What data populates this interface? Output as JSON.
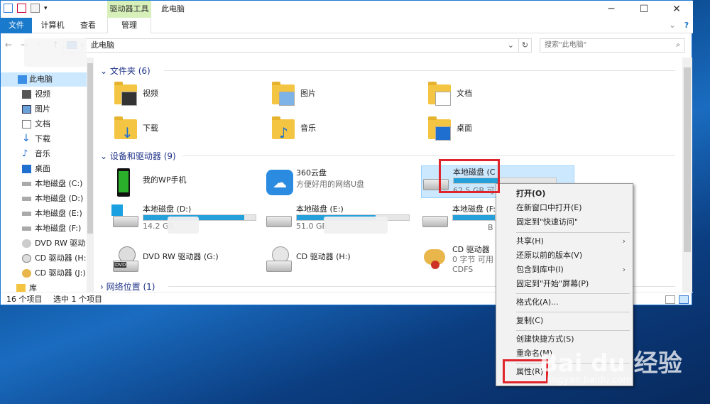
{
  "title_bar": {
    "context_tab": "驱动器工具",
    "window_title": "此电脑",
    "minimize": "─",
    "maximize": "☐",
    "close": "✕"
  },
  "ribbon": {
    "tabs": [
      "文件",
      "计算机",
      "查看",
      "管理"
    ],
    "collapse": "⌄",
    "help": "?"
  },
  "address": {
    "back": "←",
    "forward": "→",
    "dropdown": "⌄",
    "up": "↑",
    "path": "此电脑",
    "path_sep": "›",
    "history": "⌄",
    "refresh": "↻",
    "search_placeholder": "搜索\"此电脑\"",
    "search_icon": "⌕"
  },
  "sidebar": {
    "items": [
      {
        "label": "此电脑",
        "icon": "computer-icon",
        "selected": true
      },
      {
        "label": "视频",
        "icon": "video-icon"
      },
      {
        "label": "图片",
        "icon": "picture-icon"
      },
      {
        "label": "文档",
        "icon": "document-icon"
      },
      {
        "label": "下载",
        "icon": "download-icon"
      },
      {
        "label": "音乐",
        "icon": "music-icon"
      },
      {
        "label": "桌面",
        "icon": "desktop-icon"
      },
      {
        "label": "本地磁盘 (C:)",
        "icon": "drive-icon"
      },
      {
        "label": "本地磁盘 (D:)",
        "icon": "drive-icon"
      },
      {
        "label": "本地磁盘 (E:)",
        "icon": "drive-icon"
      },
      {
        "label": "本地磁盘 (F:)",
        "icon": "drive-icon"
      },
      {
        "label": "DVD RW 驱动",
        "icon": "dvd-icon"
      },
      {
        "label": "CD 驱动器 (H:",
        "icon": "cd-icon"
      },
      {
        "label": "CD 驱动器 (J:)",
        "icon": "cd-icon"
      },
      {
        "label": "库",
        "icon": "library-icon"
      }
    ]
  },
  "groups": {
    "folders": "文件夹 (6)",
    "devices": "设备和驱动器 (9)",
    "network": "网络位置 (1)",
    "chevron": "⌄",
    "chevron_right": "›"
  },
  "folders": [
    {
      "label": "视频"
    },
    {
      "label": "图片"
    },
    {
      "label": "文档"
    },
    {
      "label": "下载"
    },
    {
      "label": "音乐"
    },
    {
      "label": "桌面"
    }
  ],
  "devices": [
    {
      "label": "我的WP手机"
    },
    {
      "label": "360云盘",
      "sub": "方便好用的网络U盘"
    },
    {
      "label": "本地磁盘 (C",
      "sub": "62.5 GB 可",
      "usage": 0.45
    },
    {
      "label": "本地磁盘 (D:)",
      "sub": "14.2 GB",
      "usage": 0.9
    },
    {
      "label": "本地磁盘 (E:)",
      "sub": "51.0 GB",
      "usage": 0.7
    },
    {
      "label": "本地磁盘 (F:",
      "sub": "B 可",
      "usage": 0.6
    },
    {
      "label": "DVD RW 驱动器 (G:)"
    },
    {
      "label": "CD 驱动器 (H:)"
    },
    {
      "label": "CD 驱动器",
      "sub": "0 字节 可用",
      "sub2": "CDFS"
    }
  ],
  "status": {
    "count": "16 个项目",
    "selected": "选中 1 个项目"
  },
  "context_menu": {
    "items": [
      "打开(O)",
      "在新窗口中打开(E)",
      "固定到\"快速访问\"",
      "共享(H)",
      "还原以前的版本(V)",
      "包含到库中(I)",
      "固定到\"开始\"屏幕(P)",
      "格式化(A)...",
      "复制(C)",
      "创建快捷方式(S)",
      "重命名(M)",
      "属性(R)"
    ],
    "submenu_arrow": "›"
  },
  "watermark": {
    "brand": "Bai du 经验",
    "url": "jingyan.baidu.com"
  },
  "colors": {
    "accent": "#1979ca",
    "highlight": "#e0242c",
    "context_tab": "#d7f0b9",
    "bar": "#26a0da"
  }
}
